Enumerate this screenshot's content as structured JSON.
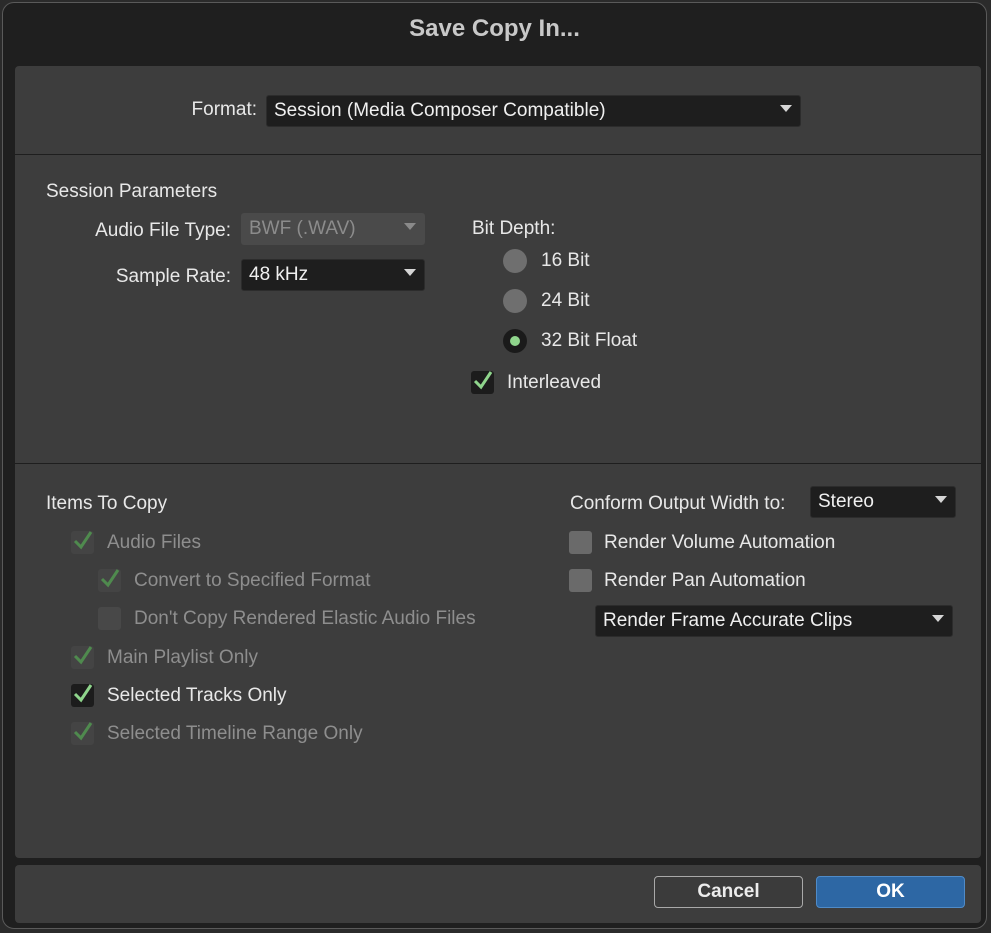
{
  "dialog": {
    "title": "Save Copy In..."
  },
  "format": {
    "label": "Format:",
    "value": "Session (Media Composer Compatible)"
  },
  "session_parameters": {
    "heading": "Session Parameters",
    "audio_file_type": {
      "label": "Audio File Type:",
      "value": "BWF (.WAV)",
      "enabled": false
    },
    "sample_rate": {
      "label": "Sample Rate:",
      "value": "48 kHz"
    },
    "bit_depth": {
      "label": "Bit Depth:",
      "options": [
        "16 Bit",
        "24 Bit",
        "32 Bit Float"
      ],
      "selected": "32 Bit Float"
    },
    "interleaved": {
      "label": "Interleaved",
      "checked": true
    }
  },
  "items_to_copy": {
    "heading": "Items To Copy",
    "audio_files": {
      "label": "Audio Files",
      "checked": true,
      "enabled": false
    },
    "convert_format": {
      "label": "Convert to Specified Format",
      "checked": true,
      "enabled": false
    },
    "dont_copy_elastic": {
      "label": "Don't Copy Rendered Elastic Audio Files",
      "checked": false,
      "enabled": false
    },
    "main_playlist": {
      "label": "Main Playlist Only",
      "checked": true,
      "enabled": false
    },
    "selected_tracks": {
      "label": "Selected Tracks Only",
      "checked": true,
      "enabled": true
    },
    "timeline_range": {
      "label": "Selected Timeline Range Only",
      "checked": true,
      "enabled": false
    }
  },
  "conform": {
    "label": "Conform Output Width to:",
    "value": "Stereo",
    "render_volume": {
      "label": "Render Volume Automation",
      "checked": false
    },
    "render_pan": {
      "label": "Render Pan Automation",
      "checked": false
    },
    "render_clips": {
      "value": "Render Frame Accurate Clips"
    }
  },
  "buttons": {
    "cancel": "Cancel",
    "ok": "OK"
  },
  "colors": {
    "accent": "#2d67a4",
    "check_green": "#8fd58c",
    "panel": "#3d3d3d"
  }
}
